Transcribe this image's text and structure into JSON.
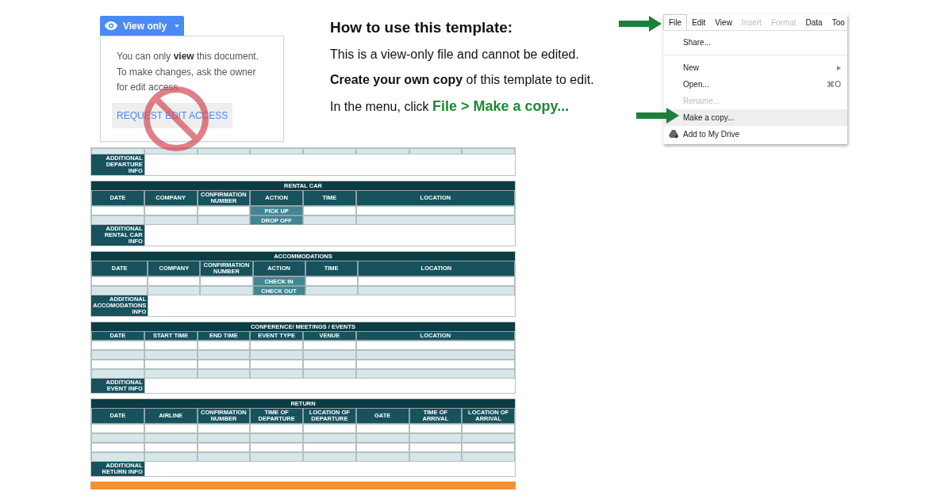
{
  "view_panel": {
    "button": "View only",
    "message": "You can only **view** this document. To make changes, ask the owner for edit access.",
    "action": "REQUEST EDIT ACCESS"
  },
  "instructions": {
    "heading": "How to use this template:",
    "lines": [
      {
        "kind": "plain",
        "text": "This is a view-only file and cannot be edited."
      },
      {
        "kind": "plain",
        "text": "**Create your own copy** of this template to edit."
      },
      {
        "kind": "highlight",
        "text": "In the menu, click **File > Make a copy...**"
      }
    ]
  },
  "menu": {
    "menubar": [
      {
        "label": "File",
        "selected": true,
        "disabled": false
      },
      {
        "label": "Edit",
        "selected": false,
        "disabled": false
      },
      {
        "label": "View",
        "selected": false,
        "disabled": false
      },
      {
        "label": "Insert",
        "selected": false,
        "disabled": true
      },
      {
        "label": "Format",
        "selected": false,
        "disabled": true
      },
      {
        "label": "Data",
        "selected": false,
        "disabled": false
      },
      {
        "label": "Too",
        "selected": false,
        "disabled": false
      }
    ],
    "items": [
      {
        "kind": "item",
        "label": "Share...",
        "disabled": false,
        "selected": false
      },
      {
        "kind": "divider"
      },
      {
        "kind": "submenu",
        "label": "New",
        "disabled": false,
        "selected": false
      },
      {
        "kind": "item",
        "label": "Open...",
        "shortcut": "⌘O",
        "disabled": false,
        "selected": false
      },
      {
        "kind": "item",
        "label": "Rename...",
        "disabled": true,
        "selected": false
      },
      {
        "kind": "item",
        "label": "Make a copy...",
        "disabled": false,
        "selected": true
      },
      {
        "kind": "drive",
        "label": "Add to My Drive",
        "disabled": false,
        "selected": false
      }
    ]
  },
  "sheet": {
    "sections": [
      {
        "rows": [
          {
            "kind": "partial"
          }
        ],
        "additional": "ADDITIONAL DEPARTURE INFO"
      },
      {
        "title": "RENTAL CAR",
        "columns": [
          {
            "label": "DATE",
            "kind": "narrow"
          },
          {
            "label": "COMPANY",
            "kind": "narrow"
          },
          {
            "label": "CONFIRMATION NUMBER",
            "kind": "narrow"
          },
          {
            "label": "ACTION",
            "kind": "narrow"
          },
          {
            "label": "TIME",
            "kind": "narrow"
          },
          {
            "label": "LOCATION",
            "kind": "wide"
          }
        ],
        "rows": [
          {
            "kind": "action",
            "action": "PICK UP"
          },
          {
            "kind": "action",
            "action": "DROP OFF"
          }
        ],
        "additional": "ADDITIONAL RENTAL CAR INFO"
      },
      {
        "title": "ACCOMMODATIONS",
        "columns": [
          {
            "label": "DATE",
            "kind": "narrow"
          },
          {
            "label": "COMPANY",
            "kind": "narrow"
          },
          {
            "label": "CONFIRMATION NUMBER",
            "kind": "narrow"
          },
          {
            "label": "ACTION",
            "kind": "narrow"
          },
          {
            "label": "TIME",
            "kind": "narrow"
          },
          {
            "label": "LOCATION",
            "kind": "wide"
          }
        ],
        "rows": [
          {
            "kind": "action",
            "action": "CHECK IN"
          },
          {
            "kind": "action",
            "action": "CHECK OUT"
          }
        ],
        "additional": "ADDITIONAL ACCOMODATIONS INFO"
      },
      {
        "title": "CONFERENCE/ MEETINGS / EVENTS",
        "columns": [
          {
            "label": "DATE",
            "kind": "narrow"
          },
          {
            "label": "START TIME",
            "kind": "narrow"
          },
          {
            "label": "END TIME",
            "kind": "narrow"
          },
          {
            "label": "EVENT TYPE",
            "kind": "narrow"
          },
          {
            "label": "VENUE",
            "kind": "narrow"
          },
          {
            "label": "LOCATION",
            "kind": "wide"
          }
        ],
        "rows": [
          {
            "kind": "blank"
          },
          {
            "kind": "blank"
          },
          {
            "kind": "blank"
          },
          {
            "kind": "blank"
          }
        ],
        "additional": "ADDITIONAL EVENT INFO"
      },
      {
        "title": "RETURN",
        "columns": [
          {
            "label": "DATE",
            "kind": "narrow"
          },
          {
            "label": "AIRLINE",
            "kind": "narrow"
          },
          {
            "label": "CONFIRMATION NUMBER",
            "kind": "narrow"
          },
          {
            "label": "TIME OF DEPARTURE",
            "kind": "narrow"
          },
          {
            "label": "LOCATION OF DEPARTURE",
            "kind": "narrow"
          },
          {
            "label": "GATE",
            "kind": "narrow"
          },
          {
            "label": "TIME OF ARRIVAL",
            "kind": "narrow"
          },
          {
            "label": "LOCATION OF ARRIVAL",
            "kind": "narrow"
          }
        ],
        "rows": [
          {
            "kind": "blank"
          },
          {
            "kind": "blank"
          },
          {
            "kind": "blank"
          },
          {
            "kind": "blank"
          }
        ],
        "additional": "ADDITIONAL RETURN INFO"
      }
    ]
  }
}
